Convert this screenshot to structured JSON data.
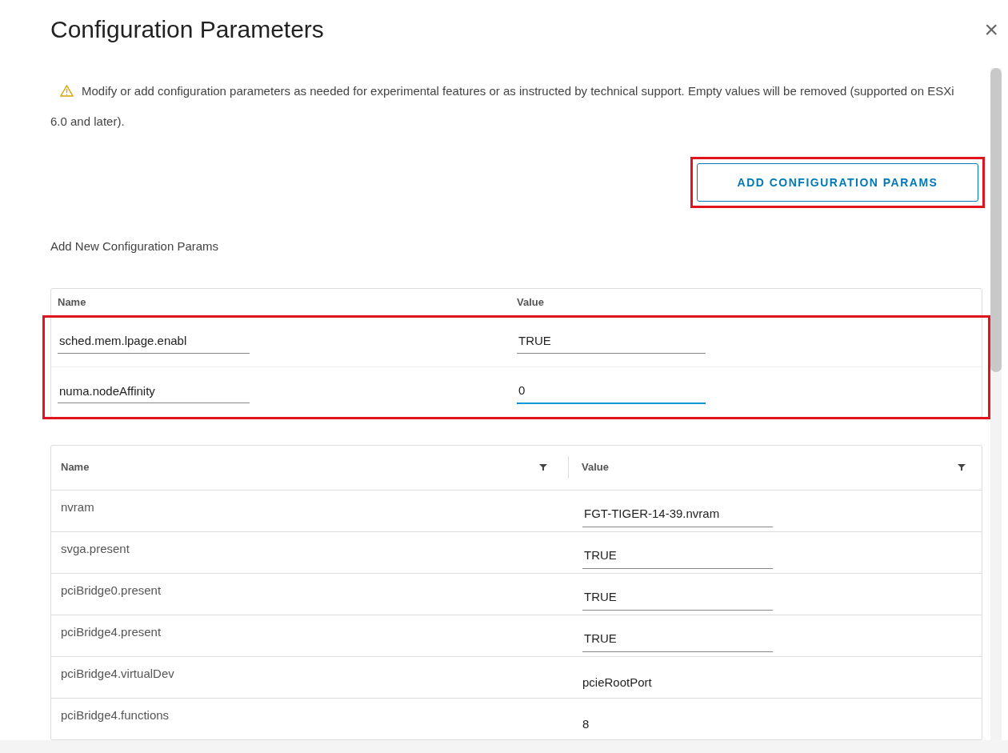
{
  "dialog": {
    "title": "Configuration Parameters",
    "close": "×"
  },
  "notice": {
    "text": "Modify or add configuration parameters as needed for experimental features or as instructed by technical support. Empty values will be removed (supported on ESXi 6.0 and later)."
  },
  "add_button": {
    "label": "ADD CONFIGURATION PARAMS",
    "highlighted": true
  },
  "new_params": {
    "heading": "Add New Configuration Params",
    "highlighted": true,
    "columns": [
      "Name",
      "Value"
    ],
    "rows": [
      {
        "name": "sched.mem.lpage.enabl",
        "value": "TRUE",
        "focused": false
      },
      {
        "name": "numa.nodeAffinity",
        "value": "0",
        "focused": true
      }
    ]
  },
  "table": {
    "columns": [
      "Name",
      "Value"
    ],
    "rows": [
      {
        "name": "nvram",
        "value": "FGT-TIGER-14-39.nvram",
        "kind": "field"
      },
      {
        "name": "svga.present",
        "value": "TRUE",
        "kind": "field"
      },
      {
        "name": "pciBridge0.present",
        "value": "TRUE",
        "kind": "field"
      },
      {
        "name": "pciBridge4.present",
        "value": "TRUE",
        "kind": "field"
      },
      {
        "name": "pciBridge4.virtualDev",
        "value": "pcieRootPort",
        "kind": "text"
      },
      {
        "name": "pciBridge4.functions",
        "value": "8",
        "kind": "text"
      }
    ]
  }
}
